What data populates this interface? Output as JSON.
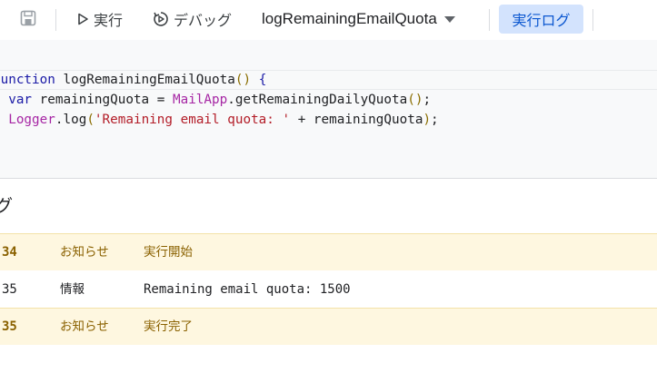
{
  "toolbar": {
    "save_icon": "save-icon",
    "run_label": "実行",
    "run_icon": "play-icon",
    "debug_label": "デバッグ",
    "debug_icon": "debug-icon",
    "function_selected": "logRemainingEmailQuota",
    "log_button_label": "実行ログ"
  },
  "editor": {
    "lines": [
      "function logRemainingEmailQuota() {",
      "  var remainingQuota = MailApp.getRemainingDailyQuota();",
      "  Logger.log('Remaining email quota: ' + remainingQuota);"
    ]
  },
  "log": {
    "title": "グ",
    "rows": [
      {
        "time": "34",
        "type": "お知らせ",
        "message": "実行開始"
      },
      {
        "time": "35",
        "type": "情報",
        "message": "Remaining email quota: 1500"
      },
      {
        "time": "35",
        "type": "お知らせ",
        "message": "実行完了"
      }
    ]
  },
  "colors": {
    "notice_bg": "#fef7e0",
    "notice_text": "#8a6100",
    "log_button_bg": "#d3e3fd",
    "log_button_text": "#0b57d0"
  }
}
